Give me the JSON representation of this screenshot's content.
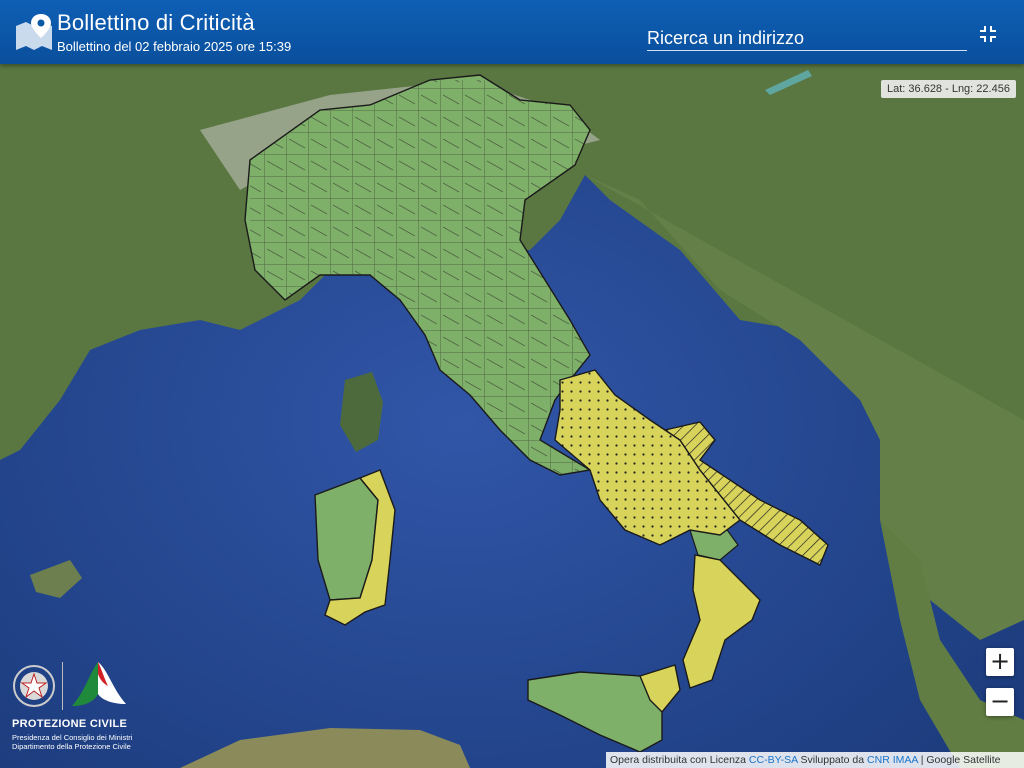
{
  "header": {
    "title": "Bollettino di Criticità",
    "subtitle": "Bollettino del 02 febbraio 2025 ore 15:39",
    "logo_icon": "map-pin-icon",
    "fullscreen_icon": "collapse-fullscreen-icon",
    "bg_color": "#0a57a8"
  },
  "search": {
    "placeholder": "Ricerca un indirizzo",
    "value": ""
  },
  "coordinates": {
    "text": "Lat: 36.628 - Lng: 22.456"
  },
  "zoom": {
    "in_label": "+",
    "out_label": "−"
  },
  "attribution": {
    "prefix": "Opera distribuita con Licenza",
    "license": "CC-BY-SA",
    "developed": "Sviluppato da",
    "developer": "CNR IMAA",
    "separator": "|",
    "tiles": "Google Satellite"
  },
  "organization": {
    "name": "PROTEZIONE CIVILE",
    "line1": "Presidenza del Consiglio dei Ministri",
    "line2": "Dipartimento della Protezione Civile"
  },
  "map": {
    "layer": "satellite",
    "colors": {
      "green_zone": "#7fb069",
      "yellow_zone": "#d9d45a",
      "sea": "#2a4f9a",
      "land": "#5b7a43"
    }
  }
}
